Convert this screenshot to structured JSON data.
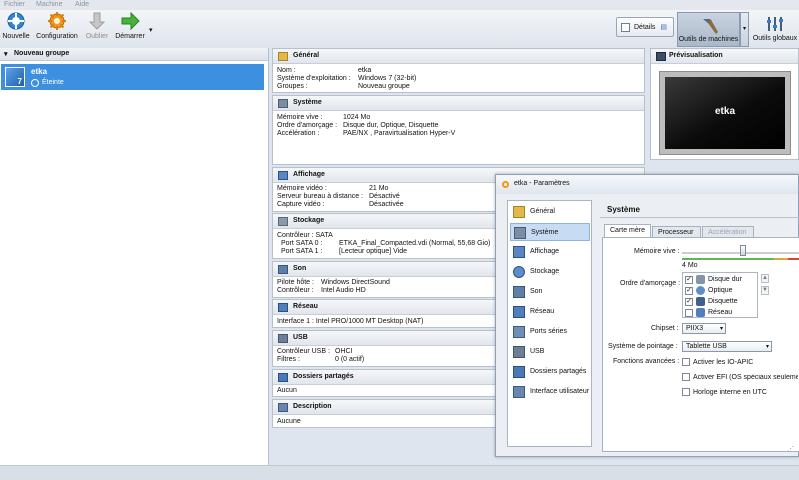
{
  "menubar": {
    "items": [
      "Fichier",
      "Machine",
      "Aide"
    ]
  },
  "toolbar": {
    "new_label": "Nouvelle",
    "settings_label": "Configuration",
    "discard_label": "Oublier",
    "start_label": "Démarrer",
    "details_label": "Détails",
    "machine_tools_label": "Outils de machines",
    "global_tools_label": "Outils globaux"
  },
  "sidebar": {
    "group_title": "Nouveau groupe",
    "vm": {
      "name": "etka",
      "state": "Éteinte",
      "os_badge": "7"
    }
  },
  "details": {
    "general": {
      "title": "Général",
      "rows": [
        [
          "Nom :",
          "etka"
        ],
        [
          "Système d'exploitation :",
          "Windows 7 (32-bit)"
        ],
        [
          "Groupes :",
          "Nouveau groupe"
        ]
      ]
    },
    "system": {
      "title": "Système",
      "rows": [
        [
          "Mémoire vive :",
          "1024 Mo"
        ],
        [
          "Ordre d'amorçage :",
          "Disque dur, Optique, Disquette"
        ],
        [
          "Accélération :",
          "PAE/NX , Paravirtualisation Hyper-V"
        ]
      ]
    },
    "display": {
      "title": "Affichage",
      "rows": [
        [
          "Mémoire vidéo :",
          "21 Mo"
        ],
        [
          "Serveur bureau à distance :",
          "Désactivé"
        ],
        [
          "Capture vidéo :",
          "Désactivée"
        ]
      ]
    },
    "storage": {
      "title": "Stockage",
      "rows": [
        [
          "Contrôleur : SATA",
          ""
        ],
        [
          " Port SATA 0 :",
          "ETKA_Final_Compacted.vdi (Normal, 55,68 Gio)"
        ],
        [
          " Port SATA 1 :",
          "[Lecteur optique] Vide"
        ]
      ]
    },
    "audio": {
      "title": "Son",
      "rows": [
        [
          "Pilote hôte :",
          "Windows DirectSound"
        ],
        [
          "Contrôleur :",
          "Intel Audio HD"
        ]
      ]
    },
    "network": {
      "title": "Réseau",
      "line": "Interface 1 :  Intel PRO/1000 MT Desktop (NAT)"
    },
    "usb": {
      "title": "USB",
      "rows": [
        [
          "Contrôleur USB :",
          "OHCI"
        ],
        [
          "Filtres :",
          "0 (0 actif)"
        ]
      ]
    },
    "shared": {
      "title": "Dossiers partagés",
      "value": "Aucun"
    },
    "description": {
      "title": "Description",
      "value": "Aucune"
    }
  },
  "preview": {
    "title": "Prévisualisation",
    "screen_text": "etka"
  },
  "dialog": {
    "title": "etka - Paramètres",
    "nav": [
      "Général",
      "Système",
      "Affichage",
      "Stockage",
      "Son",
      "Réseau",
      "Ports séries",
      "USB",
      "Dossiers partagés",
      "Interface utilisateur"
    ],
    "selected_nav": "Système",
    "pane_title": "Système",
    "tabs": [
      "Carte mère",
      "Processeur",
      "Accélération"
    ],
    "memory_label": "Mémoire vive :",
    "memory_min": "4 Mo",
    "boot_label": "Ordre d'amorçage :",
    "boot_items": [
      {
        "label": "Disque dur",
        "checked": true
      },
      {
        "label": "Optique",
        "checked": true
      },
      {
        "label": "Disquette",
        "checked": true
      },
      {
        "label": "Réseau",
        "checked": false
      }
    ],
    "chipset_label": "Chipset :",
    "chipset_value": "PIIX3",
    "pointing_label": "Système de pointage :",
    "pointing_value": "Tablette USB",
    "features_label": "Fonctions avancées :",
    "features": [
      {
        "label": "Activer les IO-APIC",
        "checked": false
      },
      {
        "label": "Activer EFI (OS spéciaux seulement)",
        "checked": false
      },
      {
        "label": "Horloge interne en UTC",
        "checked": false
      }
    ]
  }
}
